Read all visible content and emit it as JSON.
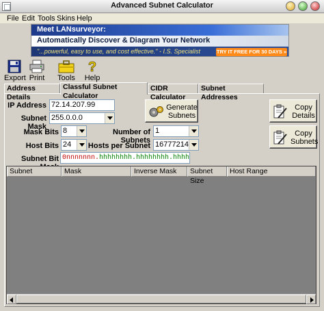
{
  "window": {
    "title": "Advanced Subnet Calculator"
  },
  "menu": {
    "file": "File",
    "edit": "Edit",
    "tools": "Tools",
    "skins": "Skins",
    "help": "Help"
  },
  "banner": {
    "headline": "Meet LANsurveyor:",
    "tagline": "Automatically Discover & Diagram Your Network",
    "quote": "\"...powerful, easy to use, and cost effective.\" - I.S. Specialist",
    "cta": "TRY IT FREE FOR 30 DAYS »"
  },
  "toolbar": {
    "export": "Export",
    "print": "Print",
    "tools": "Tools",
    "help": "Help"
  },
  "tabs": {
    "address_details": "Address Details",
    "classful": "Classful Subnet Calculator",
    "cidr": "CIDR Calculator",
    "subnet_addresses": "Subnet Addresses"
  },
  "form": {
    "ip_label": "IP Address",
    "ip_value": "72.14.207.99",
    "mask_label": "Subnet Mask",
    "mask_value": "255.0.0.0",
    "maskbits_label": "Mask Bits",
    "maskbits_value": "8",
    "hostbits_label": "Host Bits",
    "hostbits_value": "24",
    "numsubnets_label": "Number of Subnets",
    "numsubnets_value": "1",
    "hostspersubnet_label": "Hosts per Subnet",
    "hostspersubnet_value": "16777214",
    "bitmask_label": "Subnet Bit Mask",
    "bitmask_network": "0nnnnnnn.",
    "bitmask_host": "hhhhhhhh.hhhhhhhh.hhhhhhhh"
  },
  "buttons": {
    "generate_line1": "Generate",
    "generate_line2": "Subnets",
    "copydetails_line1": "Copy",
    "copydetails_line2": "Details",
    "copysubnets_line1": "Copy",
    "copysubnets_line2": "Subnets"
  },
  "grid": {
    "columns": [
      "Subnet",
      "Mask",
      "Inverse Mask",
      "Subnet Size",
      "Host Range"
    ]
  },
  "colors": {
    "bitmask_network": "#c00000",
    "bitmask_host": "#008000",
    "grid_background": "#808080",
    "banner_cta": "#ff8a1a"
  }
}
